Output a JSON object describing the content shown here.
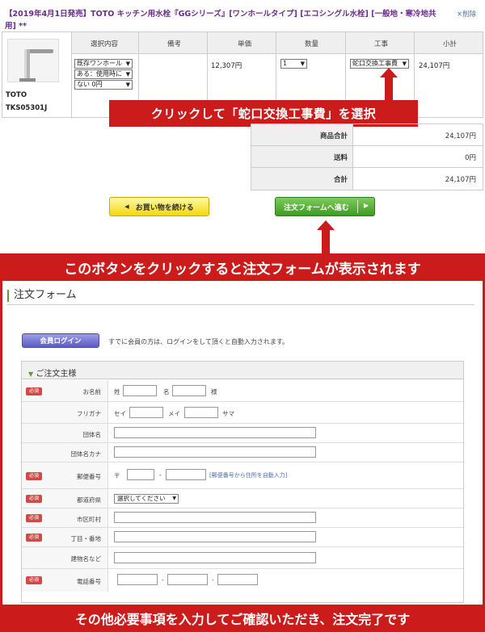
{
  "product": {
    "title": "【2019年4月1日発売】TOTO キッチン用水栓『GGシリーズ』[ワンホールタイプ] [エコシングル水栓] [一般地・寒冷地共用] **",
    "delete_label": "×削除",
    "name": "TOTO TKS05301J"
  },
  "cart": {
    "headers": [
      "選択内容",
      "備考",
      "単価",
      "数量",
      "工事",
      "小計"
    ],
    "options": [
      "既存ワンホール",
      "ある：使用時に",
      "ない 0円"
    ],
    "unit_price": "12,307円",
    "quantity": "1",
    "construction": "蛇口交換工事費",
    "subtotal": "24,107円"
  },
  "callouts": {
    "select_construction": "クリックして「蛇口交換工事費」を選択",
    "order_button": "このボタンをクリックすると注文フォームが表示されます",
    "bottom": "その他必要事項を入力してご確認いただき、注文完了です"
  },
  "totals": {
    "rows": [
      {
        "label": "商品合計",
        "value": "24,107円"
      },
      {
        "label": "送料",
        "value": "0円"
      },
      {
        "label": "合計",
        "value": "24,107円"
      }
    ]
  },
  "buttons": {
    "continue_shopping": "お買い物を続ける",
    "order_form": "注文フォームへ進む",
    "member_login": "会員ログイン"
  },
  "form": {
    "heading": "注文フォーム",
    "login_note": "すでに会員の方は、ログインをして頂くと自動入力されます。",
    "section_title": "ご注文主様",
    "required_badge": "必須",
    "fields": {
      "name": "お名前",
      "name_sei": "姓",
      "name_mei": "名",
      "name_suffix": "様",
      "furigana": "フリガナ",
      "furi_sei": "セイ",
      "furi_mei": "メイ",
      "furi_suffix": "サマ",
      "org": "団体名",
      "org_kana": "団体名カナ",
      "postal": "郵便番号",
      "postal_mark": "〒",
      "postal_link": "[郵便番号から住所を自動入力]",
      "prefecture": "都道府県",
      "prefecture_placeholder": "選択してください",
      "city": "市区町村",
      "street": "丁目・番地",
      "building": "建物名など",
      "phone": "電話番号",
      "dash": "-"
    }
  },
  "colors": {
    "callout_red": "#cc1b1b",
    "title_purple": "#6b2c8c",
    "link_blue": "#4a6fb5",
    "order_green": "#3f9a25",
    "continue_yellow": "#f2d90f",
    "login_blue": "#5b5cc5"
  },
  "icons": {
    "order_chevron": "chevron-right-icon",
    "continue_chevron": "chevron-left-icon",
    "section_marker": "triangle-down-icon",
    "callout_arrows": "arrow-up-icon"
  }
}
